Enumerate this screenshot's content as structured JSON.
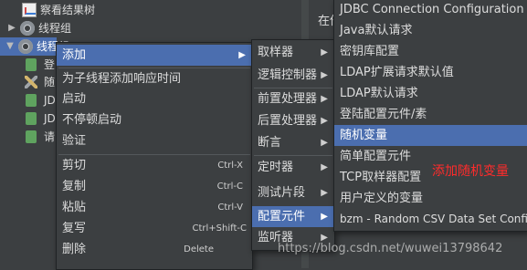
{
  "tree": {
    "items": [
      {
        "label": "察看结果树",
        "icon": "chart-icon"
      },
      {
        "label": "线程组",
        "icon": "gear-icon"
      },
      {
        "label": "线程组",
        "icon": "gear-icon"
      },
      {
        "label": "登",
        "icon": "sampler-icon"
      },
      {
        "label": "随",
        "icon": "config-icon"
      },
      {
        "label": "JD",
        "icon": "sampler-icon"
      },
      {
        "label": "JD",
        "icon": "sampler-icon"
      },
      {
        "label": "请",
        "icon": "sampler-icon"
      }
    ]
  },
  "right_panel": {
    "label": "在他"
  },
  "context_menu": {
    "items": [
      {
        "label": "添加",
        "submenu": true,
        "highlighted": true
      },
      {
        "label": "为子线程添加响应时间"
      },
      {
        "label": "启动"
      },
      {
        "label": "不停顿启动"
      },
      {
        "label": "验证"
      },
      {
        "label": "剪切",
        "shortcut": "Ctrl-X"
      },
      {
        "label": "复制",
        "shortcut": "Ctrl-C"
      },
      {
        "label": "粘贴",
        "shortcut": "Ctrl-V"
      },
      {
        "label": "复写",
        "shortcut": "Ctrl+Shift-C"
      },
      {
        "label": "删除",
        "shortcut": "Delete"
      }
    ]
  },
  "add_submenu": {
    "items": [
      {
        "label": "取样器"
      },
      {
        "label": "逻辑控制器"
      },
      {
        "label": "前置处理器"
      },
      {
        "label": "后置处理器"
      },
      {
        "label": "断言"
      },
      {
        "label": "定时器"
      },
      {
        "label": "测试片段"
      },
      {
        "label": "配置元件",
        "highlighted": true
      },
      {
        "label": "监听器"
      }
    ]
  },
  "config_submenu": {
    "items": [
      {
        "label": "JDBC Connection Configuration"
      },
      {
        "label": "Java默认请求"
      },
      {
        "label": "密钥库配置"
      },
      {
        "label": "LDAP扩展请求默认值"
      },
      {
        "label": "LDAP默认请求"
      },
      {
        "label": "登陆配置元件/素"
      },
      {
        "label": "随机变量",
        "highlighted": true
      },
      {
        "label": "简单配置元件"
      },
      {
        "label": "TCP取样器配置"
      },
      {
        "label": "用户定义的变量"
      },
      {
        "label": "bzm - Random CSV Data Set Config"
      }
    ]
  },
  "annotation": "添加随机变量",
  "watermark": "https://blog.csdn.net/wuwei13798642",
  "colors": {
    "background": "#3c3f41",
    "highlight": "#4b6eaf",
    "annotation": "#ff2b2b"
  }
}
